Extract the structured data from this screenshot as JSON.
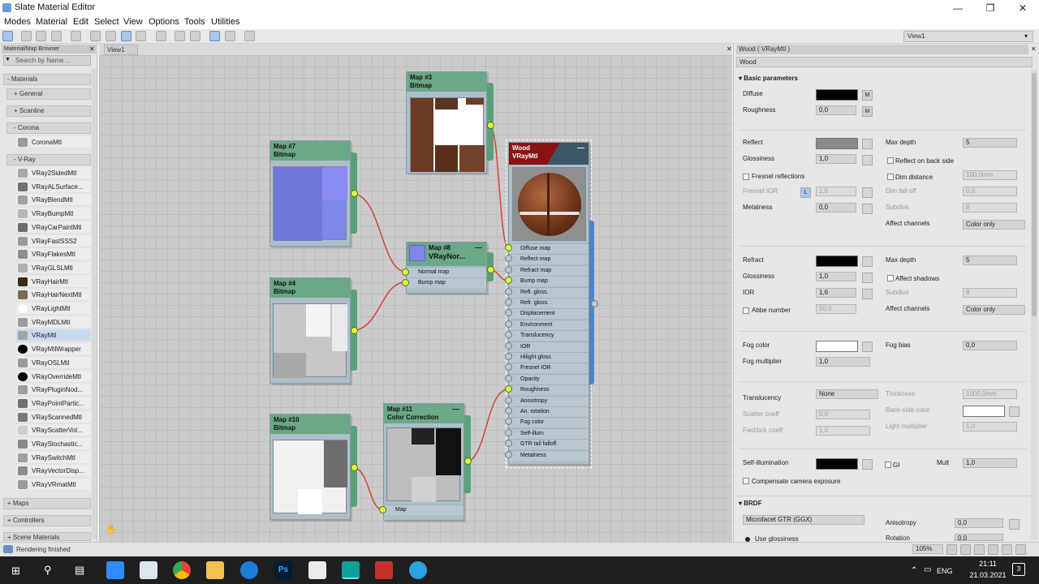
{
  "window": {
    "title": "Slate Material Editor"
  },
  "menu": [
    "Modes",
    "Material",
    "Edit",
    "Select",
    "View",
    "Options",
    "Tools",
    "Utilities"
  ],
  "toolbar": {
    "view_selector": "View1"
  },
  "browser": {
    "title": "Material/Map Browser",
    "search_placeholder": "Search by Name ...",
    "materials_header": "- Materials",
    "general": "+ General",
    "scanline": "+ Scanline",
    "corona": "- Corona",
    "corona_items": [
      "CoronaMtl"
    ],
    "vray": "- V-Ray",
    "vray_items": [
      "VRay2SidedMtl",
      "VRayALSurface...",
      "VRayBlendMtl",
      "VRayBumpMtl",
      "VRayCarPaintMtl",
      "VRayFastSSS2",
      "VRayFlakesMtl",
      "VRayGLSLMtl",
      "VRayHairMtl",
      "VRayHairNextMtl",
      "VRayLightMtl",
      "VRayMDLMtl",
      "VRayMtl",
      "VRayMtlWrapper",
      "VRayOSLMtl",
      "VRayOverrideMtl",
      "VRayPluginNod...",
      "VRayPointPartic...",
      "VRayScannedMtl",
      "VRayScatterVol...",
      "VRayStochastic...",
      "VRaySwitchMtl",
      "VRayVectorDisp...",
      "VRayVRmatMtl"
    ],
    "maps": "+ Maps",
    "controllers": "+ Controllers",
    "scene_materials": "+ Scene Materials"
  },
  "view": {
    "tab": "View1",
    "nodes": {
      "map3": {
        "title": "Map #3",
        "type": "Bitmap"
      },
      "map7": {
        "title": "Map #7",
        "type": "Bitmap"
      },
      "map4": {
        "title": "Map #4",
        "type": "Bitmap"
      },
      "map10": {
        "title": "Map #10",
        "type": "Bitmap"
      },
      "map8": {
        "title": "Map #8",
        "type": "VRayNor...",
        "slots": [
          "Normal map",
          "Bump map"
        ]
      },
      "map11": {
        "title": "Map #11",
        "type": "Color Correction",
        "slots": [
          "Map"
        ]
      },
      "wood": {
        "title": "Wood",
        "type": "VRayMtl",
        "slots": [
          "Diffuse map",
          "Reflect map",
          "Refract map",
          "Bump map",
          "Refl. gloss.",
          "Refr. gloss.",
          "Displacement",
          "Environment",
          "Translucency",
          "IOR",
          "Hilight gloss",
          "Fresnel IOR",
          "Opacity",
          "Roughness",
          "Anisotropy",
          "An. rotation",
          "Fog color",
          "Self-illum",
          "GTR tail falloff",
          "Metalness"
        ]
      }
    }
  },
  "params": {
    "title": "Wood  ( VRayMtl )",
    "name": "Wood",
    "basic_header": "Basic parameters",
    "diffuse": "Diffuse",
    "m": "M",
    "roughness": "Roughness",
    "roughness_val": "0,0",
    "reflect": "Reflect",
    "glossiness": "Glossiness",
    "gloss_val": "1,0",
    "fresnel": "Fresnel reflections",
    "fresnel_ior": "Fresnel IOR",
    "l": "L",
    "fresnel_ior_val": "1,6",
    "metalness": "Metalness",
    "metal_val": "0,0",
    "max_depth": "Max depth",
    "max_depth_val": "5",
    "reflect_back": "Reflect on back side",
    "dim_distance": "Dim distance",
    "dim_distance_val": "100,0mm",
    "dim_falloff": "Dim fall off",
    "dim_falloff_val": "0,0",
    "subdivs": "Subdivs",
    "subdivs_val": "8",
    "affect_channels": "Affect channels",
    "affect_val": "Color only",
    "refract": "Refract",
    "r_gloss_val": "1,0",
    "ior": "IOR",
    "ior_val": "1,6",
    "abbe": "Abbe number",
    "abbe_val": "50,0",
    "r_max_depth_val": "5",
    "affect_shadows": "Affect shadows",
    "r_subdivs_val": "8",
    "r_affect_val": "Color only",
    "fog_color": "Fog color",
    "fog_bias": "Fog bias",
    "fog_bias_val": "0,0",
    "fog_mult": "Fog multiplier",
    "fog_mult_val": "1,0",
    "translucency": "Translucency",
    "transl_val": "None",
    "thickness": "Thickness",
    "thickness_val": "1000,0mm",
    "scatter_coeff": "Scatter coeff",
    "scatter_val": "0,0",
    "backside_color": "Back-side color",
    "fwd_bck": "Fwd/bck coeff",
    "fwd_val": "1,0",
    "light_mult": "Light multiplier",
    "light_mult_val": "1,0",
    "self_illum": "Self-illumination",
    "gi": "GI",
    "mult": "Mult",
    "mult_val": "1,0",
    "compensate": "Compensate camera exposure",
    "brdf_header": "BRDF",
    "brdf_val": "Microfacet GTR (GGX)",
    "anisotropy": "Anisotropy",
    "aniso_val": "0,0",
    "rotation": "Rotation",
    "rot_val": "0,0",
    "use_glossiness": "Use glossiness",
    "colors": {
      "diffuse": "#000000",
      "reflect": "#8a8a8a",
      "refract": "#000000",
      "fog": "#ffffff",
      "backside": "#ffffff",
      "self_illum": "#000000"
    }
  },
  "status": {
    "text": "Rendering finished",
    "zoom": "105%"
  },
  "taskbar": {
    "lang": "ENG",
    "time": "21:11",
    "date": "21.03.2021",
    "notif": "3"
  }
}
